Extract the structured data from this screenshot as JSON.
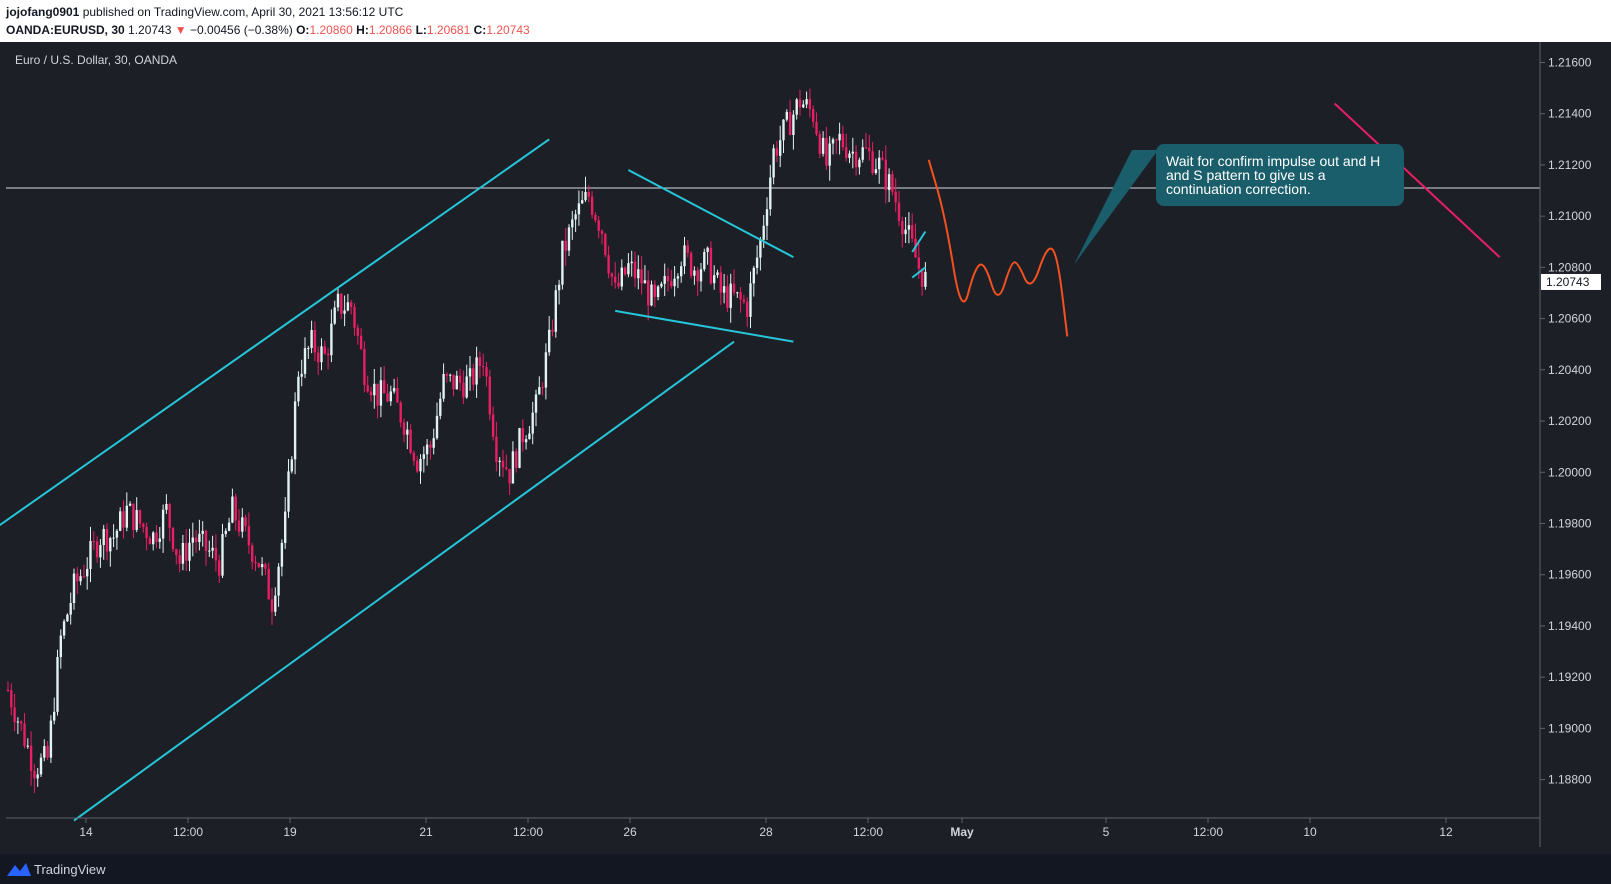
{
  "header": {
    "author": "jojofang0901",
    "published_text": " published on TradingView.com, April 30, 2021 13:56:12 UTC",
    "symbol": "OANDA:EURUSD, 30",
    "last_price": "1.20743",
    "change_arrow": "▼",
    "change": "−0.00456 (−0.38%)",
    "open_label": "O:",
    "open": "1.20860",
    "high_label": "H:",
    "high": "1.20866",
    "low_label": "L:",
    "low": "1.20681",
    "close_label": "C:",
    "close": "1.20743"
  },
  "chart_title": "Euro / U.S. Dollar, 30, OANDA",
  "callout": {
    "text": "Wait for confirm impulse out and H and S pattern to give us a continuation correction."
  },
  "footer": {
    "brand": "TradingView"
  },
  "colors": {
    "background": "#1c1f26",
    "candle_up": "#e0f2f1",
    "candle_down": "#e91e63",
    "trendline": "#26c6da",
    "projection": "#f4511e",
    "downtrend": "#e91e63",
    "horizontal_level": "#b2b5be",
    "callout_bg": "#1b5e6b",
    "price_label_bg": "#ffffff"
  },
  "chart_data": {
    "type": "candlestick",
    "title": "Euro / U.S. Dollar, 30, OANDA",
    "ylim": [
      1.1865,
      1.2168
    ],
    "y_ticks": [
      "1.21600",
      "1.21400",
      "1.21200",
      "1.21000",
      "1.20800",
      "1.20600",
      "1.20400",
      "1.20200",
      "1.20000",
      "1.19800",
      "1.19600",
      "1.19400",
      "1.19200",
      "1.19000",
      "1.18800"
    ],
    "x_ticks": [
      "14",
      "12:00",
      "19",
      "21",
      "12:00",
      "26",
      "28",
      "12:00",
      "May",
      "5",
      "12:00",
      "10",
      "12"
    ],
    "current_price_label": "1.20743",
    "horizontal_level": 1.2111,
    "price_path": [
      [
        0,
        1.1915
      ],
      [
        2,
        1.19
      ],
      [
        4,
        1.1885
      ],
      [
        6,
        1.1888
      ],
      [
        8,
        1.1935
      ],
      [
        10,
        1.1955
      ],
      [
        12,
        1.1965
      ],
      [
        14,
        1.1975
      ],
      [
        16,
        1.1975
      ],
      [
        18,
        1.1985
      ],
      [
        20,
        1.198
      ],
      [
        22,
        1.1975
      ],
      [
        24,
        1.1985
      ],
      [
        26,
        1.1965
      ],
      [
        28,
        1.1975
      ],
      [
        30,
        1.197
      ],
      [
        32,
        1.1965
      ],
      [
        34,
        1.1985
      ],
      [
        36,
        1.1975
      ],
      [
        38,
        1.1965
      ],
      [
        40,
        1.195
      ],
      [
        42,
        1.198
      ],
      [
        44,
        1.204
      ],
      [
        46,
        1.205
      ],
      [
        48,
        1.2045
      ],
      [
        50,
        1.2065
      ],
      [
        52,
        1.2065
      ],
      [
        54,
        1.204
      ],
      [
        56,
        1.203
      ],
      [
        58,
        1.203
      ],
      [
        60,
        1.202
      ],
      [
        62,
        1.2005
      ],
      [
        64,
        1.201
      ],
      [
        66,
        1.2035
      ],
      [
        68,
        1.2035
      ],
      [
        70,
        1.2035
      ],
      [
        72,
        1.2045
      ],
      [
        74,
        1.201
      ],
      [
        76,
        1.2
      ],
      [
        78,
        1.2015
      ],
      [
        80,
        1.2025
      ],
      [
        82,
        1.205
      ],
      [
        84,
        1.2085
      ],
      [
        86,
        1.21
      ],
      [
        88,
        1.2108
      ],
      [
        90,
        1.2095
      ],
      [
        92,
        1.207
      ],
      [
        94,
        1.208
      ],
      [
        96,
        1.2075
      ],
      [
        98,
        1.2065
      ],
      [
        100,
        1.2075
      ],
      [
        102,
        1.2085
      ],
      [
        104,
        1.208
      ],
      [
        106,
        1.2082
      ],
      [
        108,
        1.207
      ],
      [
        110,
        1.2068
      ],
      [
        112,
        1.2065
      ],
      [
        114,
        1.209
      ],
      [
        116,
        1.2125
      ],
      [
        118,
        1.2135
      ],
      [
        120,
        1.2145
      ],
      [
        122,
        1.214
      ],
      [
        124,
        1.212
      ],
      [
        126,
        1.213
      ],
      [
        128,
        1.2125
      ],
      [
        130,
        1.2125
      ],
      [
        132,
        1.212
      ],
      [
        134,
        1.211
      ],
      [
        136,
        1.2095
      ],
      [
        138,
        1.208
      ],
      [
        139,
        1.2075
      ]
    ],
    "trendlines": [
      {
        "name": "channel-top",
        "points": [
          [
            -2,
            1.1978
          ],
          [
            82,
            1.213
          ]
        ]
      },
      {
        "name": "channel-bottom",
        "points": [
          [
            10,
            1.1864
          ],
          [
            110,
            1.2051
          ]
        ]
      },
      {
        "name": "pennant-top",
        "points": [
          [
            94,
            1.2118
          ],
          [
            119,
            1.2084
          ]
        ]
      },
      {
        "name": "pennant-bottom",
        "points": [
          [
            92,
            1.2063
          ],
          [
            119,
            1.2051
          ]
        ]
      },
      {
        "name": "small-channel-top",
        "points": [
          [
            137,
            1.2086
          ],
          [
            139,
            1.2094
          ]
        ]
      },
      {
        "name": "small-channel-bottom",
        "points": [
          [
            137,
            1.2076
          ],
          [
            139,
            1.208
          ]
        ]
      },
      {
        "name": "downtrend",
        "points": [
          [
            201,
            1.2144
          ],
          [
            226,
            1.2084
          ]
        ]
      }
    ],
    "projection_path": [
      [
        139.5,
        1.2122
      ],
      [
        142,
        1.21
      ],
      [
        144.5,
        1.206
      ],
      [
        146.5,
        1.208
      ],
      [
        148,
        1.2082
      ],
      [
        150,
        1.2065
      ],
      [
        152,
        1.2082
      ],
      [
        153,
        1.2082
      ],
      [
        155,
        1.207
      ],
      [
        157.5,
        1.2089
      ],
      [
        159,
        1.2085
      ],
      [
        160.5,
        1.2053
      ]
    ],
    "callout_pointer": [
      161.5,
      1.2081
    ]
  }
}
